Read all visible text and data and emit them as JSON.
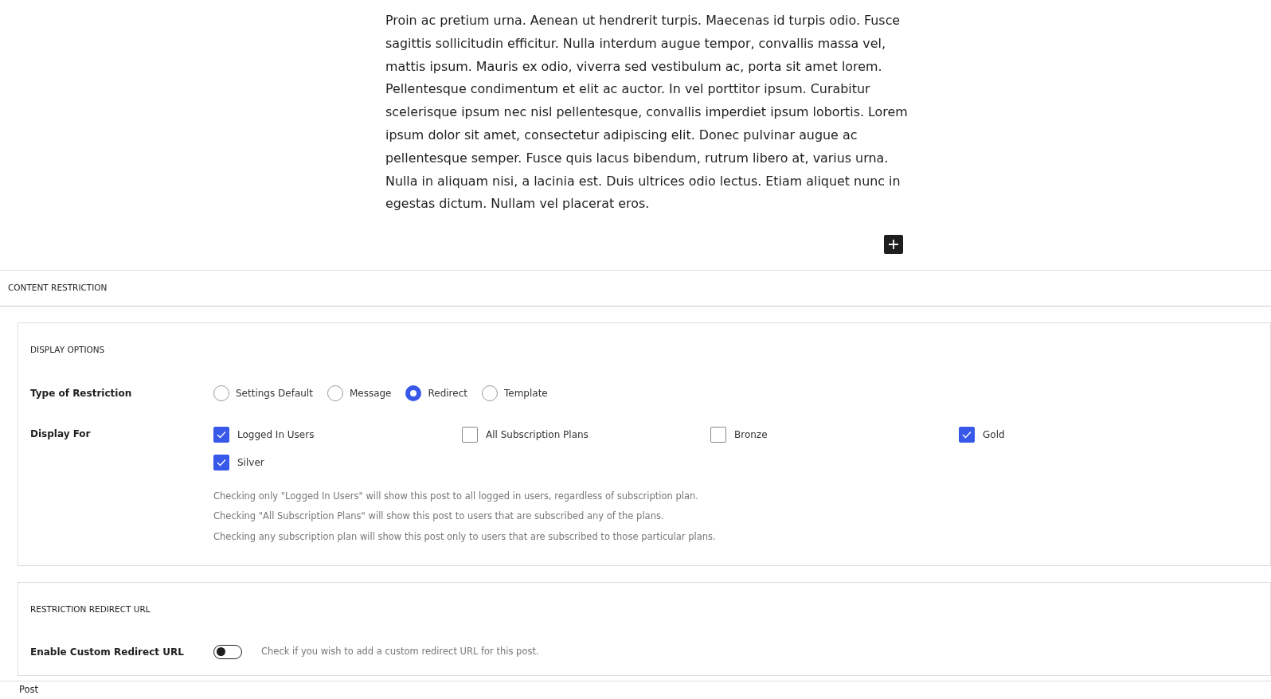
{
  "body_text": "Proin ac pretium urna. Aenean ut hendrerit turpis. Maecenas id turpis odio. Fusce sagittis sollicitudin efficitur. Nulla interdum augue tempor, convallis massa vel, mattis ipsum. Mauris ex odio, viverra sed vestibulum ac, porta sit amet lorem. Pellentesque condimentum et elit ac auctor. In vel porttitor ipsum. Curabitur scelerisque ipsum nec nisl pellentesque, convallis imperdiet ipsum lobortis. Lorem ipsum dolor sit amet, consectetur adipiscing elit. Donec pulvinar augue ac pellentesque semper. Fusce quis lacus bibendum, rutrum libero at, varius urna. Nulla in aliquam nisi, a lacinia est. Duis ultrices odio lectus. Etiam aliquet nunc in egestas dictum. Nullam vel placerat eros.",
  "panel": {
    "title": "CONTENT RESTRICTION"
  },
  "display_options": {
    "title": "DISPLAY OPTIONS",
    "restriction_type": {
      "label": "Type of Restriction",
      "options": [
        {
          "label": "Settings Default",
          "selected": false
        },
        {
          "label": "Message",
          "selected": false
        },
        {
          "label": "Redirect",
          "selected": true
        },
        {
          "label": "Template",
          "selected": false
        }
      ]
    },
    "display_for": {
      "label": "Display For",
      "options": [
        {
          "label": "Logged In Users",
          "checked": true
        },
        {
          "label": "All Subscription Plans",
          "checked": false
        },
        {
          "label": "Bronze",
          "checked": false
        },
        {
          "label": "Gold",
          "checked": true
        },
        {
          "label": "Silver",
          "checked": true
        }
      ],
      "help": [
        "Checking only \"Logged In Users\" will show this post to all logged in users, regardless of subscription plan.",
        "Checking \"All Subscription Plans\" will show this post to users that are subscribed any of the plans.",
        "Checking any subscription plan will show this post only to users that are subscribed to those particular plans."
      ]
    }
  },
  "redirect_url": {
    "title": "RESTRICTION REDIRECT URL",
    "label": "Enable Custom Redirect URL",
    "on": false,
    "help": "Check if you wish to add a custom redirect URL for this post."
  },
  "footer": "Post"
}
